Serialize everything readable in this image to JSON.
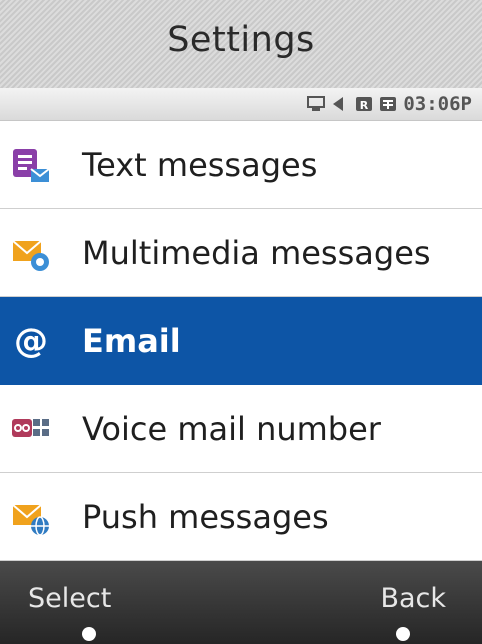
{
  "header": {
    "title": "Settings"
  },
  "status": {
    "time": "03:06P",
    "icons": [
      "computer-icon",
      "speaker-icon",
      "r-badge-icon",
      "grid-badge-icon"
    ]
  },
  "menu": {
    "items": [
      {
        "label": "Text messages",
        "icon": "text-message-icon",
        "selected": false
      },
      {
        "label": "Multimedia messages",
        "icon": "multimedia-message-icon",
        "selected": false
      },
      {
        "label": "Email",
        "icon": "at-icon",
        "selected": true
      },
      {
        "label": "Voice mail number",
        "icon": "voicemail-icon",
        "selected": false
      },
      {
        "label": "Push messages",
        "icon": "push-message-icon",
        "selected": false
      }
    ]
  },
  "softkeys": {
    "left": "Select",
    "right": "Back"
  },
  "colors": {
    "selected_bg": "#0d55a6",
    "softkey_bg": "#2f2f2f"
  }
}
